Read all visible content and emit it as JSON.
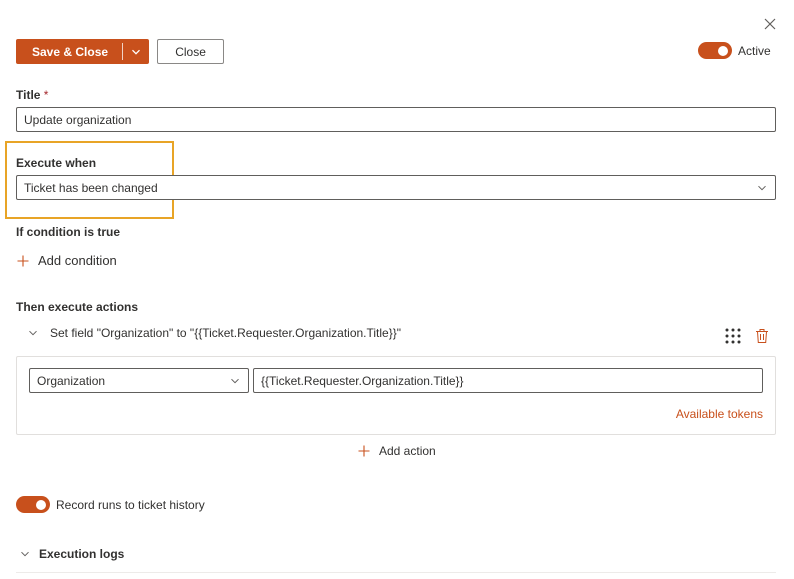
{
  "dialog": {
    "close_icon": "close-icon"
  },
  "toolbar": {
    "save_close_label": "Save & Close",
    "close_label": "Close"
  },
  "active_toggle": {
    "label": "Active",
    "on": true
  },
  "title_field": {
    "label": "Title",
    "required_marker": "*",
    "value": "Update organization"
  },
  "execute_when": {
    "label": "Execute when",
    "selected": "Ticket has been changed"
  },
  "conditions": {
    "label": "If condition is true",
    "add_label": "Add condition"
  },
  "actions": {
    "label": "Then execute actions",
    "items": [
      {
        "summary": "Set field \"Organization\" to \"{{Ticket.Requester.Organization.Title}}\"",
        "field": "Organization",
        "value": "{{Ticket.Requester.Organization.Title}}",
        "tokens_link": "Available tokens"
      }
    ],
    "add_label": "Add action"
  },
  "record_history": {
    "label": "Record runs to ticket history",
    "on": true
  },
  "execution_logs": {
    "label": "Execution logs"
  },
  "colors": {
    "accent": "#c8501c",
    "highlight": "#e8a426",
    "border": "#605e5c"
  }
}
